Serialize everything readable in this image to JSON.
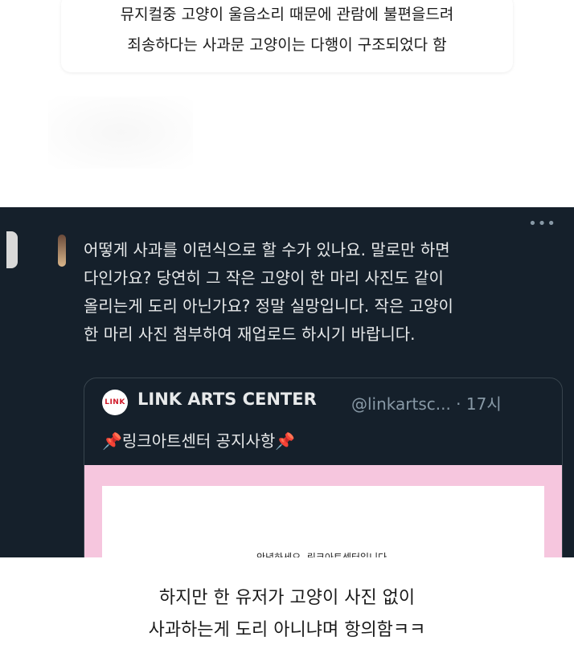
{
  "top_caption": {
    "line1": "뮤지컬중 고양이 울음소리 때문에 관람에 불편을드려",
    "line2": "죄송하다는 사과문 고양이는 다행이 구조되었다 함"
  },
  "tweet": {
    "more": "•••",
    "lines": [
      "어떻게 사과를 이런식으로 할 수가 있나요. 말로만 하면",
      "다인가요? 당연히 그 작은 고양이 한 마리 사진도 같이",
      "올리는게 도리 아닌가요? 정말 실망입니다. 작은 고양이",
      "한 마리 사진 첨부하여 재업로드 하시기 바랍니다."
    ],
    "quote": {
      "logo_text": "LINK",
      "name": "LINK ARTS CENTER",
      "handle": "@linkartsc... · 17시",
      "pin_left": "📌",
      "text": "링크아트센터 공지사항",
      "pin_right": "📌",
      "image_text": "안녕하세요, 링크아트센터입니다."
    }
  },
  "bottom_caption": {
    "line1": "하지만 한 유저가 고양이 사진 없이",
    "line2": "사과하는게 도리 아니냐며 항의함ㅋㅋ"
  }
}
